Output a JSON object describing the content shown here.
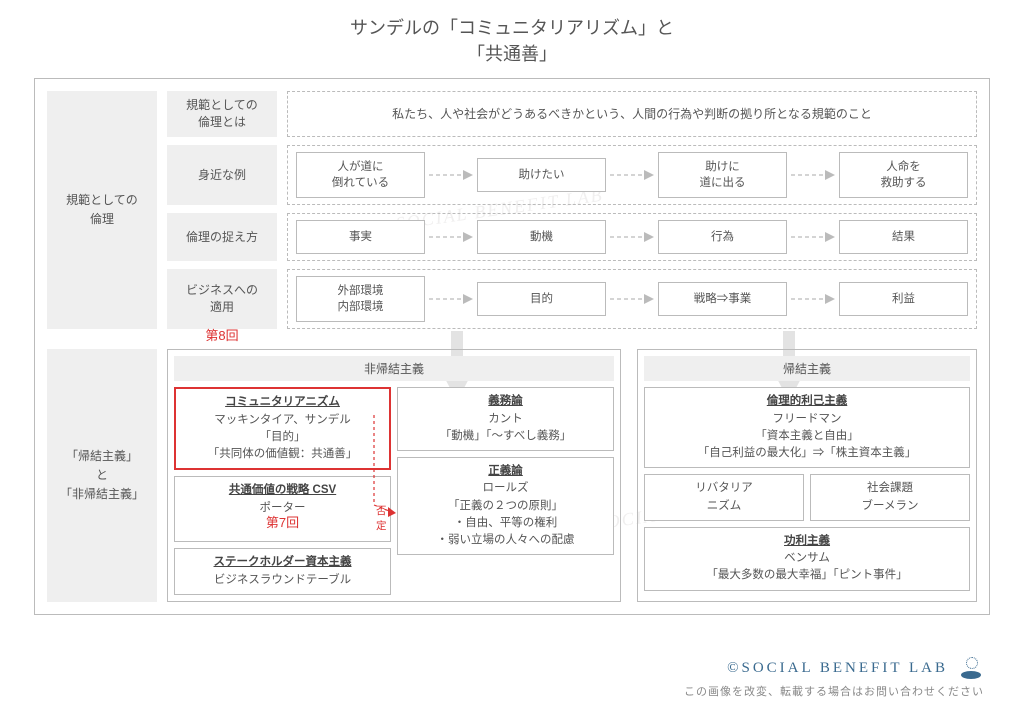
{
  "title_line1": "サンデルの「コミュニタリアリズム」と",
  "title_line2": "「共通善」",
  "section1": {
    "vlabel": "規範としての\n倫理",
    "rows": [
      {
        "label": "規範としての\n倫理とは",
        "type": "text",
        "text": "私たち、人や社会がどうあるべきかという、人間の行為や判断の拠り所となる規範のこと"
      },
      {
        "label": "身近な例",
        "type": "flow",
        "nodes": [
          "人が道に\n倒れている",
          "助けたい",
          "助けに\n道に出る",
          "人命を\n救助する"
        ]
      },
      {
        "label": "倫理の捉え方",
        "type": "flow",
        "nodes": [
          "事実",
          "動機",
          "行為",
          "結果"
        ]
      },
      {
        "label": "ビジネスへの\n適用",
        "type": "flow",
        "nodes": [
          "外部環境\n内部環境",
          "目的",
          "戦略⇒事業",
          "利益"
        ],
        "tag": "第8回"
      }
    ]
  },
  "section2": {
    "vlabel": "「帰結主義」\nと\n「非帰結主義」",
    "left": {
      "header": "非帰結主義",
      "left_cards": [
        {
          "h": "コミュニタリアニズム",
          "lines": [
            "マッキンタイア、サンデル",
            "「目的」",
            "「共同体の価値観：共通善」"
          ],
          "red": true
        },
        {
          "h": "共通価値の戦略 CSV",
          "lines": [
            "ポーター"
          ],
          "tag": "第7回"
        },
        {
          "h": "ステークホルダー資本主義",
          "lines": [
            "ビジネスラウンドテーブル"
          ]
        }
      ],
      "right_cards": [
        {
          "h": "義務論",
          "lines": [
            "カント",
            "「動機」「～すべし義務」"
          ]
        },
        {
          "h": "正義論",
          "lines": [
            "ロールズ",
            "「正義の２つの原則」",
            "・自由、平等の権利",
            "・弱い立場の人々への配慮"
          ],
          "neg": "否定"
        }
      ]
    },
    "right": {
      "header": "帰結主義",
      "cards": [
        {
          "h": "倫理的利己主義",
          "lines": [
            "フリードマン",
            "「資本主義と自由」",
            "「自己利益の最大化」⇒「株主資本主義」"
          ],
          "sub": [
            {
              "lines": [
                "リバタリア\nニズム"
              ]
            },
            {
              "lines": [
                "社会課題\nブーメラン"
              ]
            }
          ]
        },
        {
          "h": "功利主義",
          "lines": [
            "ベンサム",
            "「最大多数の最大幸福」「ピント事件」"
          ]
        }
      ]
    }
  },
  "footer": {
    "brand": "©SOCIAL BENEFIT LAB",
    "note": "この画像を改変、転載する場合はお問い合わせください"
  },
  "watermark": "SOCIAL BENEFIT LAB"
}
